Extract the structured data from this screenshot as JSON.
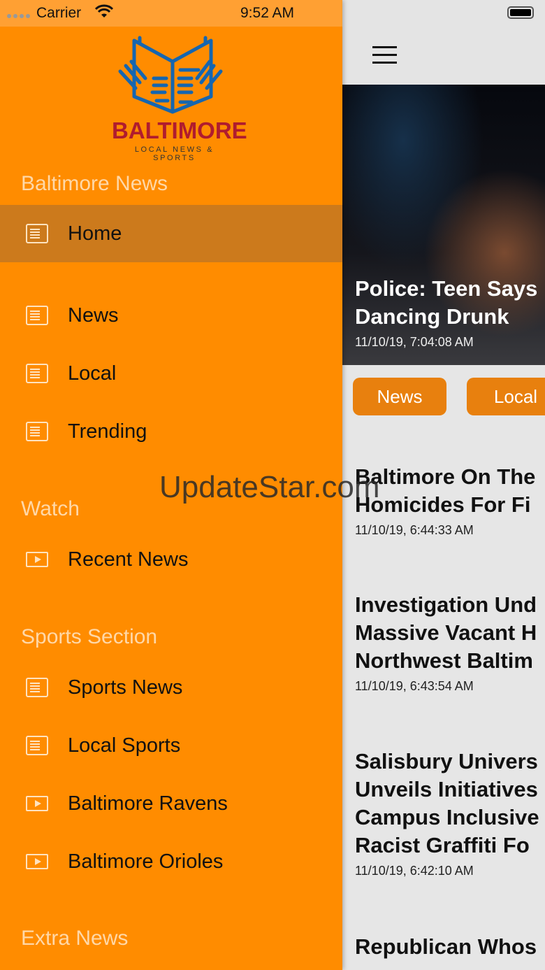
{
  "status_bar": {
    "carrier": "Carrier",
    "time": "9:52 AM"
  },
  "logo": {
    "title": "BALTIMORE",
    "subtitle": "LOCAL NEWS & SPORTS"
  },
  "drawer": {
    "sections": [
      {
        "title": "Baltimore News",
        "items": [
          {
            "label": "Home",
            "icon": "newspaper-icon",
            "selected": true
          },
          {
            "label": "News",
            "icon": "newspaper-icon"
          },
          {
            "label": "Local",
            "icon": "newspaper-icon"
          },
          {
            "label": "Trending",
            "icon": "newspaper-icon"
          }
        ]
      },
      {
        "title": "Watch",
        "items": [
          {
            "label": "Recent News",
            "icon": "video-icon"
          }
        ]
      },
      {
        "title": "Sports Section",
        "items": [
          {
            "label": "Sports News",
            "icon": "newspaper-icon"
          },
          {
            "label": "Local Sports",
            "icon": "newspaper-icon"
          },
          {
            "label": "Baltimore Ravens",
            "icon": "video-icon"
          },
          {
            "label": "Baltimore Orioles",
            "icon": "video-icon"
          }
        ]
      },
      {
        "title": "Extra News",
        "items": []
      }
    ]
  },
  "hero": {
    "title": "Police: Teen Says Dancing Drunk",
    "line1": "Police: Teen Says",
    "line2": "Dancing Drunk",
    "date": "11/10/19, 7:04:08 AM"
  },
  "chips": [
    "News",
    "Local"
  ],
  "articles": [
    {
      "lines": [
        "Baltimore On The",
        "Homicides For Fi"
      ],
      "date": "11/10/19, 6:44:33 AM"
    },
    {
      "lines": [
        "Investigation Und",
        "Massive Vacant H",
        "Northwest Baltim"
      ],
      "date": "11/10/19, 6:43:54 AM"
    },
    {
      "lines": [
        "Salisbury Univers",
        "Unveils Initiatives",
        "Campus Inclusive",
        "Racist Graffiti Fo"
      ],
      "date": "11/10/19, 6:42:10 AM"
    },
    {
      "lines": [
        "Republican Whos"
      ],
      "date": ""
    }
  ],
  "watermark": "UpdateStar.com",
  "colors": {
    "drawer": "#ff8c00",
    "selected": "#cc7a1c",
    "chip": "#e8800e",
    "logo_red": "#b01c2e",
    "logo_blue": "#1566b0"
  }
}
